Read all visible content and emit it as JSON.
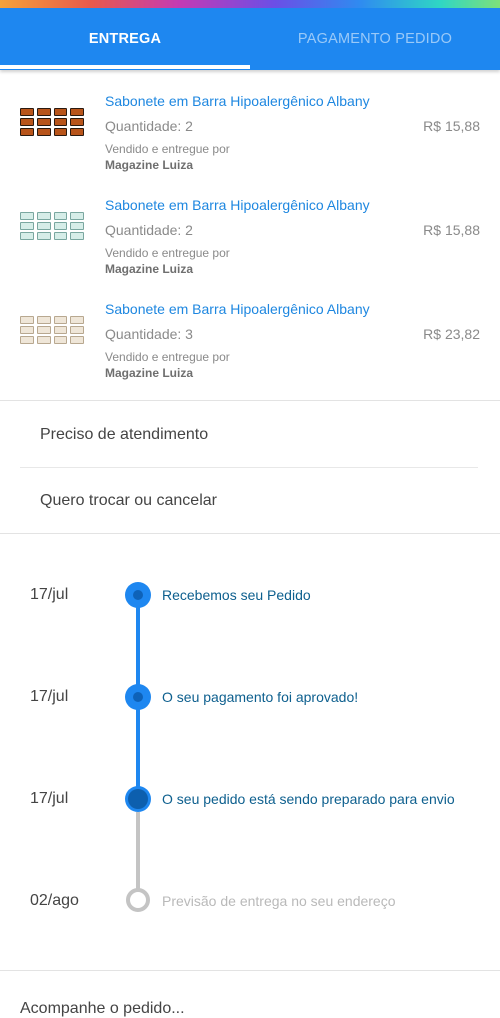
{
  "tabs": [
    {
      "label": "ENTREGA",
      "active": true
    },
    {
      "label": "PAGAMENTO PEDIDO",
      "active": false
    }
  ],
  "colors": {
    "primary": "#1e87f0",
    "link": "#1e87e0",
    "muted": "#8a8a8a",
    "timeline_done": "#1e87f0",
    "timeline_pending": "#c4c4c4"
  },
  "items": [
    {
      "title": "Sabonete em Barra Hipoalergênico Albany",
      "quantity": "Quantidade: 2",
      "price": "R$ 15,88",
      "sold_by": "Vendido e entregue por",
      "seller": "Magazine Luiza",
      "thumb_icon": "soap-pack-orange-icon"
    },
    {
      "title": "Sabonete em Barra Hipoalergênico Albany",
      "quantity": "Quantidade: 2",
      "price": "R$ 15,88",
      "sold_by": "Vendido e entregue por",
      "seller": "Magazine Luiza",
      "thumb_icon": "soap-pack-green-icon"
    },
    {
      "title": "Sabonete em Barra Hipoalergênico Albany",
      "quantity": "Quantidade: 3",
      "price": "R$ 23,82",
      "sold_by": "Vendido e entregue por",
      "seller": "Magazine Luiza",
      "thumb_icon": "soap-pack-cream-icon"
    }
  ],
  "actions": [
    "Preciso de atendimento",
    "Quero trocar ou cancelar"
  ],
  "timeline": [
    {
      "date": "17/jul",
      "text": "Recebemos seu Pedido",
      "status": "done"
    },
    {
      "date": "17/jul",
      "text": "O seu pagamento foi aprovado!",
      "status": "done"
    },
    {
      "date": "17/jul",
      "text": "O seu pedido está sendo preparado para envio",
      "status": "current"
    },
    {
      "date": "02/ago",
      "text": "Previsão de entrega no seu endereço",
      "status": "pending"
    }
  ],
  "footer_partial": "Acompanhe o pedido..."
}
